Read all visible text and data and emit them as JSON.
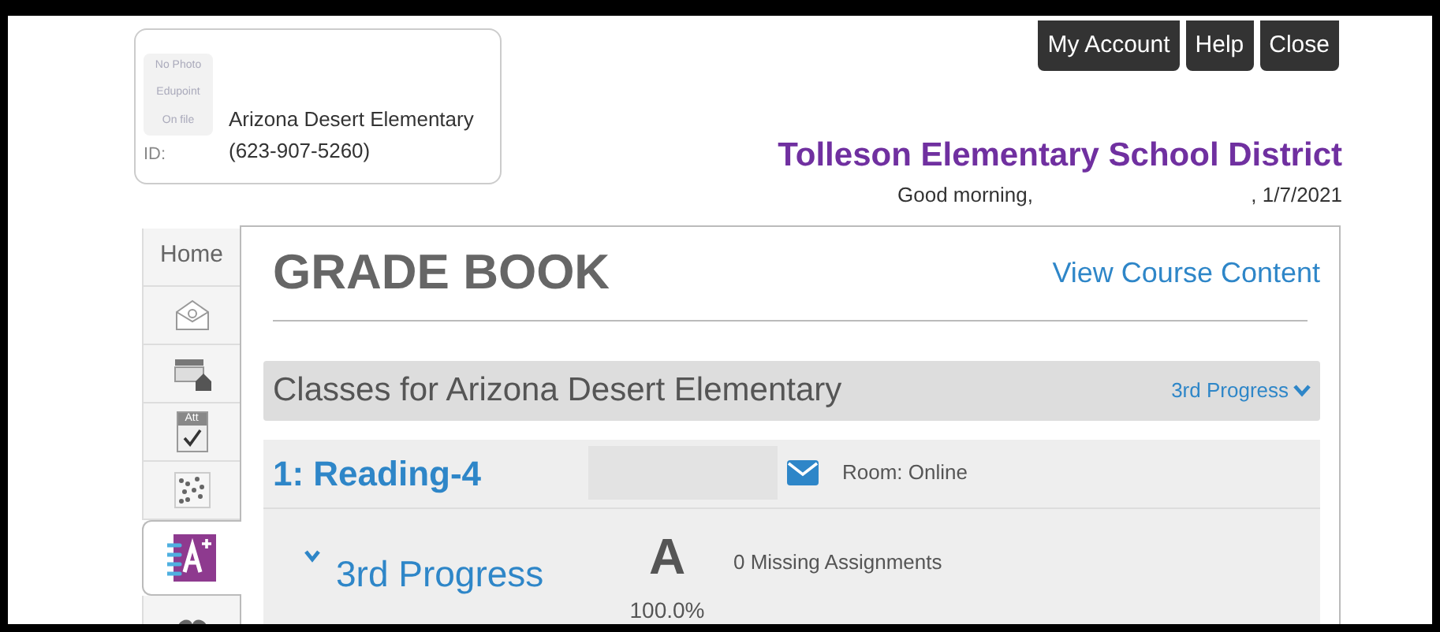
{
  "profile": {
    "photo_lines": [
      "No Photo",
      "Edupoint",
      "On file"
    ],
    "id_label": "ID:",
    "school": "Arizona Desert Elementary",
    "phone": "(623-907-5260)"
  },
  "header_buttons": [
    "My Account",
    "Help",
    "Close"
  ],
  "district": "Tolleson Elementary School District",
  "greeting": {
    "text": "Good morning,",
    "date": ", 1/7/2021"
  },
  "nav_tabs": [
    {
      "kind": "text",
      "label": "Home",
      "selected": false
    },
    {
      "kind": "mail",
      "selected": false
    },
    {
      "kind": "calendar",
      "selected": false
    },
    {
      "kind": "attendance",
      "label": "Att",
      "selected": false
    },
    {
      "kind": "dots",
      "selected": false
    },
    {
      "kind": "grade",
      "selected": true
    },
    {
      "kind": "partial",
      "selected": false
    }
  ],
  "page_title": "GRADE BOOK",
  "course_link": "View Course Content",
  "classes_header": {
    "title": "Classes for Arizona Desert Elementary",
    "period": "3rd Progress"
  },
  "classes": [
    {
      "name": "1: Reading-4",
      "room": "Room: Online",
      "marks": [
        {
          "period": "3rd Progress",
          "expanded": true,
          "grade": "A",
          "percent": "100.0%",
          "missing": "0 Missing Assignments"
        }
      ]
    }
  ]
}
